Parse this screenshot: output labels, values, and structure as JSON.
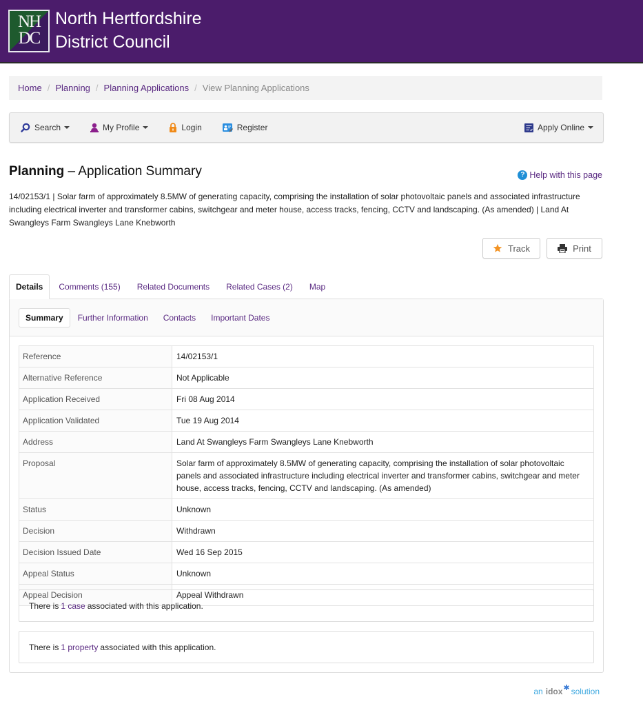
{
  "header": {
    "logo_lines": [
      "NH",
      "DC"
    ],
    "site_name_line1": "North Hertfordshire",
    "site_name_line2": "District Council",
    "brand_color": "#4b1c6b"
  },
  "breadcrumb": {
    "items": [
      {
        "label": "Home"
      },
      {
        "label": "Planning"
      },
      {
        "label": "Planning Applications"
      }
    ],
    "current": "View Planning Applications",
    "separator": "/"
  },
  "navbar": {
    "search": {
      "label": "Search",
      "icon": "search-icon"
    },
    "profile": {
      "label": "My Profile",
      "icon": "user-icon"
    },
    "login": {
      "label": "Login",
      "icon": "lock-icon"
    },
    "register": {
      "label": "Register",
      "icon": "register-icon"
    },
    "apply_online": {
      "label": "Apply Online",
      "icon": "form-icon"
    }
  },
  "page": {
    "title_bold": "Planning",
    "title_rest": " – Application Summary",
    "help_label": "Help with this page",
    "summary": "14/02153/1 | Solar farm of approximately 8.5MW of generating capacity, comprising the installation of solar photovoltaic panels and associated infrastructure including electrical inverter and transformer cabins, switchgear and meter house, access tracks, fencing, CCTV and landscaping. (As amended) | Land At Swangleys Farm Swangleys Lane Knebworth"
  },
  "actions": {
    "track_label": "Track",
    "print_label": "Print"
  },
  "tabs": [
    {
      "label": "Details",
      "active": true
    },
    {
      "label": "Comments (155)"
    },
    {
      "label": "Related Documents"
    },
    {
      "label": "Related Cases (2)"
    },
    {
      "label": "Map"
    }
  ],
  "subtabs": [
    {
      "label": "Summary",
      "active": true
    },
    {
      "label": "Further Information"
    },
    {
      "label": "Contacts"
    },
    {
      "label": "Important Dates"
    }
  ],
  "details": [
    {
      "label": "Reference",
      "value": "14/02153/1"
    },
    {
      "label": "Alternative Reference",
      "value": "Not Applicable"
    },
    {
      "label": "Application Received",
      "value": "Fri 08 Aug 2014"
    },
    {
      "label": "Application Validated",
      "value": "Tue 19 Aug 2014"
    },
    {
      "label": "Address",
      "value": "Land At Swangleys Farm Swangleys Lane Knebworth"
    },
    {
      "label": "Proposal",
      "value": "Solar farm of approximately 8.5MW of generating capacity, comprising the installation of solar photovoltaic panels and associated infrastructure including electrical inverter and transformer cabins, switchgear and meter house, access tracks, fencing, CCTV and landscaping. (As amended)"
    },
    {
      "label": "Status",
      "value": "Unknown"
    },
    {
      "label": "Decision",
      "value": "Withdrawn"
    },
    {
      "label": "Decision Issued Date",
      "value": "Wed 16 Sep 2015"
    },
    {
      "label": "Appeal Status",
      "value": "Unknown"
    },
    {
      "label": "Appeal Decision",
      "value": "Appeal Withdrawn"
    }
  ],
  "associations": {
    "case": {
      "prefix": "There is",
      "link": "1 case",
      "suffix": "associated with this application."
    },
    "property": {
      "prefix": "There is",
      "link": "1 property",
      "suffix": "associated with this application."
    }
  },
  "footer": {
    "brand_prefix": "an",
    "brand_name": "idox",
    "brand_suffix": "solution"
  }
}
